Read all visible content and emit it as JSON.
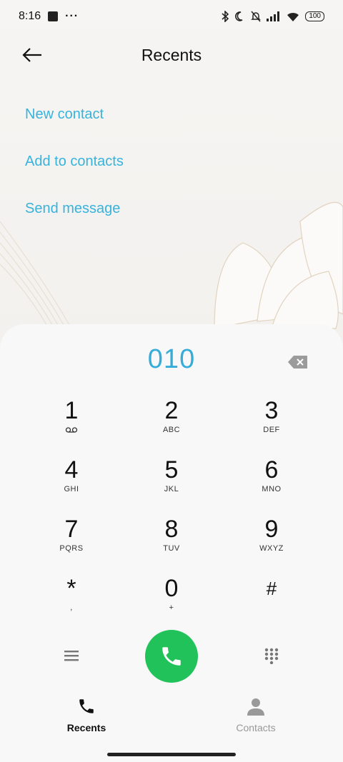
{
  "status_bar": {
    "time": "8:16",
    "dots": "···",
    "battery": "100",
    "icons": [
      "bluetooth-icon",
      "moon-icon",
      "bell-muted-icon",
      "signal-icon",
      "wifi-icon",
      "battery-icon"
    ]
  },
  "header": {
    "title": "Recents",
    "back_icon": "arrow-left-icon"
  },
  "actions": [
    {
      "label": "New contact"
    },
    {
      "label": "Add to contacts"
    },
    {
      "label": "Send message"
    }
  ],
  "dialer": {
    "number": "010",
    "keys": [
      {
        "digit": "1",
        "letters": "",
        "icon": "voicemail-icon"
      },
      {
        "digit": "2",
        "letters": "ABC"
      },
      {
        "digit": "3",
        "letters": "DEF"
      },
      {
        "digit": "4",
        "letters": "GHI"
      },
      {
        "digit": "5",
        "letters": "JKL"
      },
      {
        "digit": "6",
        "letters": "MNO"
      },
      {
        "digit": "7",
        "letters": "PQRS"
      },
      {
        "digit": "8",
        "letters": "TUV"
      },
      {
        "digit": "9",
        "letters": "WXYZ"
      },
      {
        "digit": "*",
        "letters": ","
      },
      {
        "digit": "0",
        "letters": "+"
      },
      {
        "digit": "#",
        "letters": ""
      }
    ]
  },
  "bottom_nav": {
    "recents": "Recents",
    "contacts": "Contacts"
  },
  "colors": {
    "accent": "#37b3dc",
    "call": "#22c25b"
  }
}
